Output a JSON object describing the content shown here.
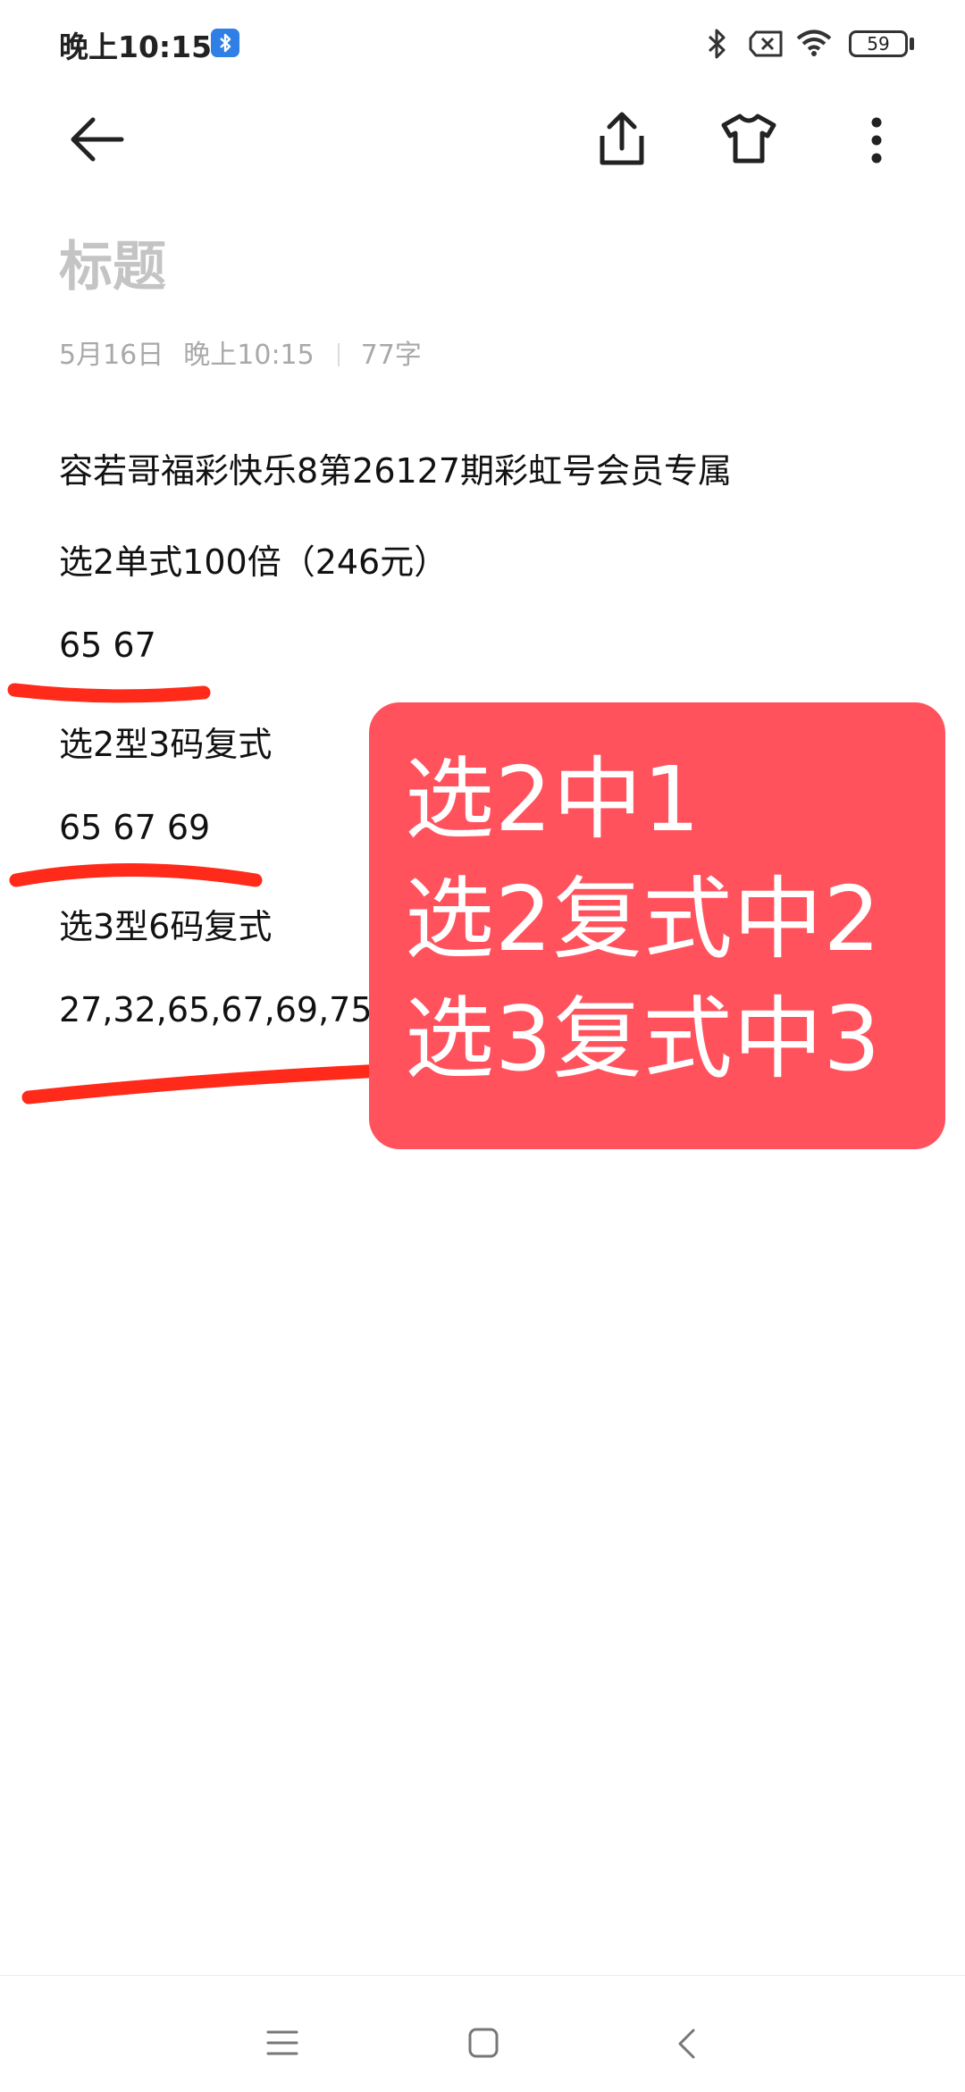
{
  "status_bar": {
    "time": "晚上10:15",
    "battery": "59",
    "icons": [
      "bluetooth-badge-icon",
      "bluetooth-icon",
      "sim-off-icon",
      "wifi-icon",
      "battery-icon"
    ]
  },
  "toolbar": {
    "icons": [
      "back-arrow-icon",
      "share-icon",
      "theme-shirt-icon",
      "more-vertical-icon"
    ]
  },
  "note": {
    "title_placeholder": "标题",
    "date": "5月16日",
    "time": "晚上10:15",
    "word_count": "77字",
    "lines": [
      "容若哥福彩快乐8第26127期彩虹号会员专属",
      "选2单式100倍（246元）",
      "65 67",
      "选2型3码复式",
      "65 67 69",
      "选3型6码复式",
      "27,32,65,67,69,75"
    ]
  },
  "overlay": {
    "lines": [
      "选2中1",
      "选2复式中2",
      "选3复式中3"
    ],
    "background": "#ff525d",
    "text_color": "#ffffff"
  },
  "annotation_color": "#ff2a1a",
  "bottom_nav": {
    "icons": [
      "menu-icon",
      "home-square-icon",
      "back-chevron-icon"
    ]
  }
}
